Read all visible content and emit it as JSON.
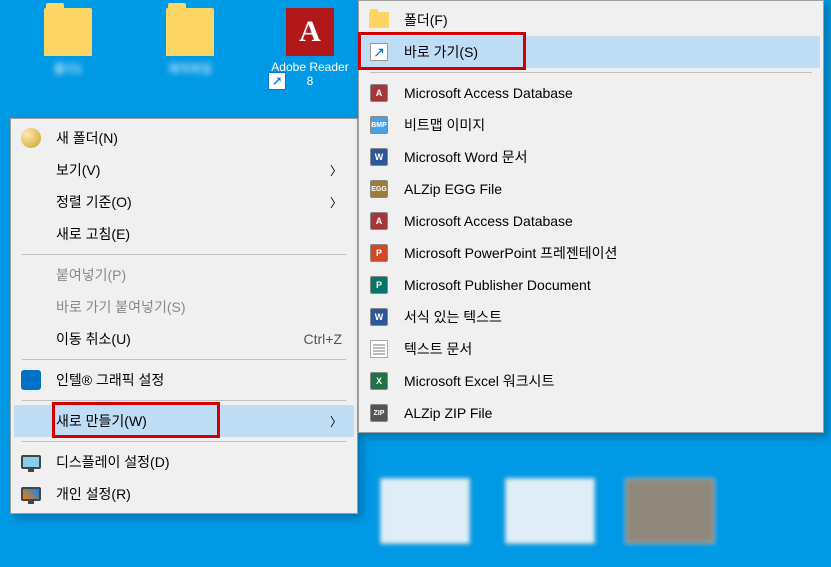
{
  "desktop": {
    "icons": [
      {
        "label": "폴더1",
        "type": "folder"
      },
      {
        "label": "제작파일",
        "type": "folder"
      },
      {
        "label": "Adobe Reader 8",
        "type": "adobe"
      }
    ]
  },
  "context_menu": {
    "new_folder": "새 폴더(N)",
    "view": "보기(V)",
    "sort_by": "정렬 기준(O)",
    "refresh": "새로 고침(E)",
    "paste": "붙여넣기(P)",
    "paste_shortcut": "바로 가기 붙여넣기(S)",
    "undo_move": "이동 취소(U)",
    "undo_move_shortcut": "Ctrl+Z",
    "intel_graphics": "인텔® 그래픽 설정",
    "new": "새로 만들기(W)",
    "display_settings": "디스플레이 설정(D)",
    "personalize": "개인 설정(R)"
  },
  "submenu": {
    "folder": "폴더(F)",
    "shortcut": "바로 가기(S)",
    "access_db": "Microsoft Access Database",
    "bitmap": "비트맵 이미지",
    "word": "Microsoft Word 문서",
    "egg": "ALZip EGG File",
    "access_db2": "Microsoft Access Database",
    "powerpoint": "Microsoft PowerPoint 프레젠테이션",
    "publisher": "Microsoft Publisher Document",
    "rtf": "서식 있는 텍스트",
    "text": "텍스트 문서",
    "excel": "Microsoft Excel 워크시트",
    "zip": "ALZip ZIP File"
  }
}
